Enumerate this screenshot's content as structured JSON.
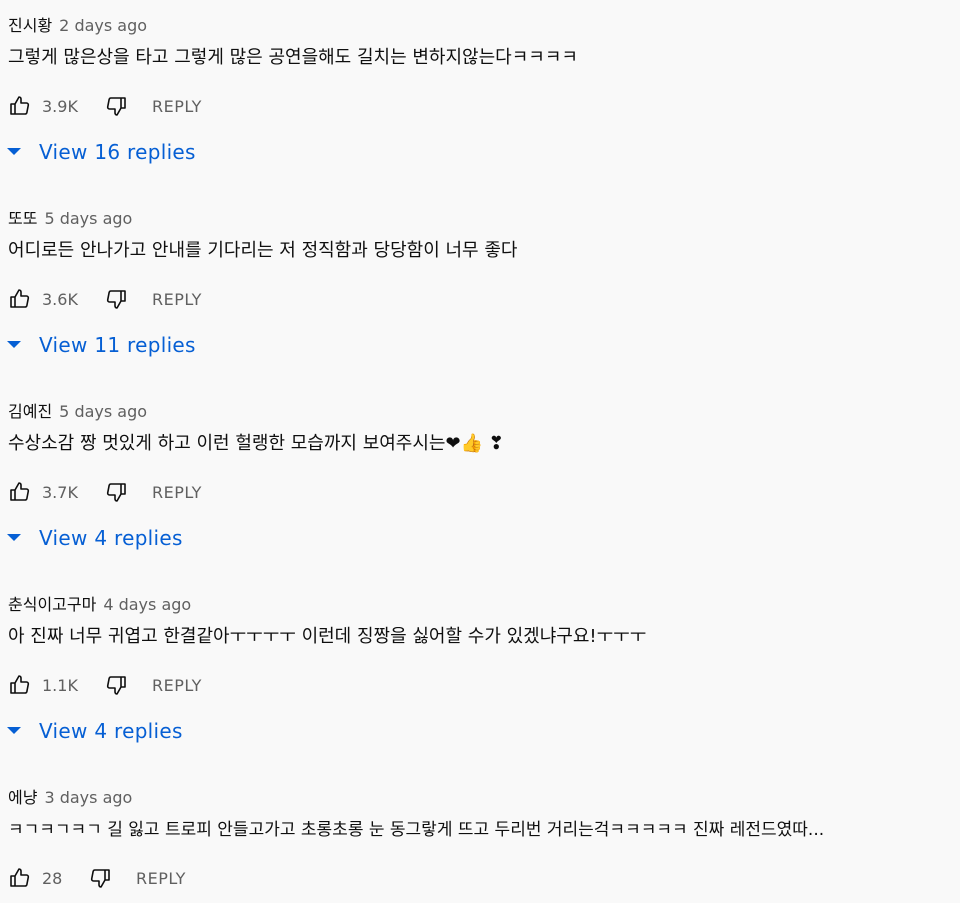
{
  "comments": [
    {
      "author": "진시황",
      "time": "2 days ago",
      "text": "그렇게 많은상을 타고 그렇게 많은 공연을해도 길치는 변하지않는다ㅋㅋㅋㅋ",
      "likes": "3.9K",
      "reply_label": "REPLY",
      "replies_label": "View 16 replies"
    },
    {
      "author": "또또",
      "time": "5 days ago",
      "text": "어디로든 안나가고 안내를 기다리는 저 정직함과 당당함이 너무 좋다",
      "likes": "3.6K",
      "reply_label": "REPLY",
      "replies_label": "View 11 replies"
    },
    {
      "author": "김예진",
      "time": "5 days ago",
      "text": "수상소감 짱 멋있게 하고 이런 헐랭한 모습까지 보여주시는❤👍 ❣",
      "likes": "3.7K",
      "reply_label": "REPLY",
      "replies_label": "View 4 replies"
    },
    {
      "author": "춘식이고구마",
      "time": "4 days ago",
      "text": "아 진짜 너무 귀엽고 한결같아ㅜㅜㅜㅜ 이런데 징짱을 싫어할 수가 있겠냐구요!ㅜㅜㅜ",
      "likes": "1.1K",
      "reply_label": "REPLY",
      "replies_label": "View 4 replies"
    },
    {
      "author": "에냥",
      "time": "3 days ago",
      "text": "ㅋㄱㅋㄱㅋㄱ 길 잃고 트로피 안들고가고 초롱초롱 눈 동그랗게 뜨고 두리번 거리는걱ㅋㅋㅋㅋㅋ 진짜 레전드였따...",
      "likes": "28",
      "reply_label": "REPLY"
    }
  ],
  "colors": {
    "background": "#f9f9f9",
    "text": "#0f0f0f",
    "secondary": "#606060",
    "link": "#065fd4"
  }
}
